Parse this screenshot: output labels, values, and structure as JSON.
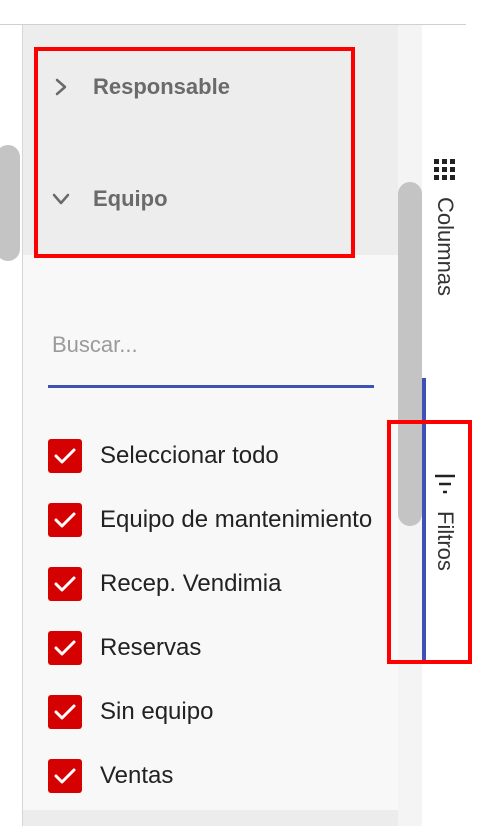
{
  "groups": [
    {
      "label": "Responsable",
      "state": "collapsed"
    },
    {
      "label": "Equipo",
      "state": "expanded"
    }
  ],
  "search": {
    "placeholder": "Buscar...",
    "value": ""
  },
  "checkboxes": [
    {
      "label": "Seleccionar todo",
      "checked": true
    },
    {
      "label": "Equipo de mantenimiento",
      "checked": true
    },
    {
      "label": "Recep. Vendimia",
      "checked": true
    },
    {
      "label": "Reservas",
      "checked": true
    },
    {
      "label": "Sin equipo",
      "checked": true
    },
    {
      "label": "Ventas",
      "checked": true
    }
  ],
  "side_tabs": {
    "columns_label": "Columnas",
    "filters_label": "Filtros",
    "active": "Filtros"
  },
  "colors": {
    "accent": "#3f51b5",
    "checkbox": "#d50000",
    "highlight": "#ff0000"
  },
  "icons": {
    "collapsed": "chevron-right-icon",
    "expanded": "chevron-down-icon",
    "columns": "grid-icon",
    "filters": "filter-icon",
    "check": "check-icon"
  }
}
